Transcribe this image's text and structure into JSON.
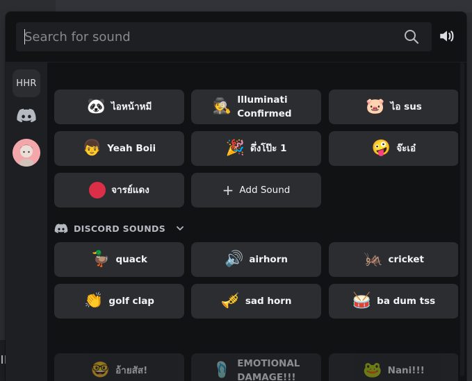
{
  "search": {
    "placeholder": "Search for sound",
    "value": ""
  },
  "guilds": [
    {
      "label": "HHR"
    }
  ],
  "custom_sounds": [
    {
      "emoji": "🐼",
      "label": "ไอหน้าหมี"
    },
    {
      "emoji": "🕵️",
      "label": "Illuminati Confirmed"
    },
    {
      "emoji": "🐷",
      "label": "ไอ sus"
    },
    {
      "emoji": "👦",
      "label": "Yeah Boii"
    },
    {
      "emoji": "🎉",
      "label": "ดึ่งโป๊ะ 1"
    },
    {
      "emoji": "🤪",
      "label": "จ๊ะเอ๋"
    },
    {
      "emoji": "",
      "label": "จารย์แดง"
    },
    {
      "emoji": "+",
      "label": "Add Sound"
    }
  ],
  "section": {
    "title": "DISCORD SOUNDS"
  },
  "discord_sounds": [
    {
      "emoji": "🦆",
      "label": "quack"
    },
    {
      "emoji": "🔊",
      "label": "airhorn"
    },
    {
      "emoji": "🦗",
      "label": "cricket"
    },
    {
      "emoji": "👏",
      "label": "golf clap"
    },
    {
      "emoji": "🎺",
      "label": "sad horn"
    },
    {
      "emoji": "🥁",
      "label": "ba dum tss"
    }
  ],
  "partial_sounds": [
    {
      "emoji": "🤓",
      "label": "อ้ายสัส!"
    },
    {
      "emoji": "🩴",
      "label": "EMOTIONAL DAMAGE!!!"
    },
    {
      "emoji": "🐸",
      "label": "Nani!!!"
    }
  ],
  "icons": {
    "search": "search-icon",
    "volume": "speaker-volume-icon",
    "discord": "discord-logo-icon",
    "chevron": "chevron-down-icon"
  },
  "colors": {
    "panel": "#111214",
    "button": "#2b2d31",
    "rail": "#1e1f22",
    "red": "#da2f46"
  }
}
